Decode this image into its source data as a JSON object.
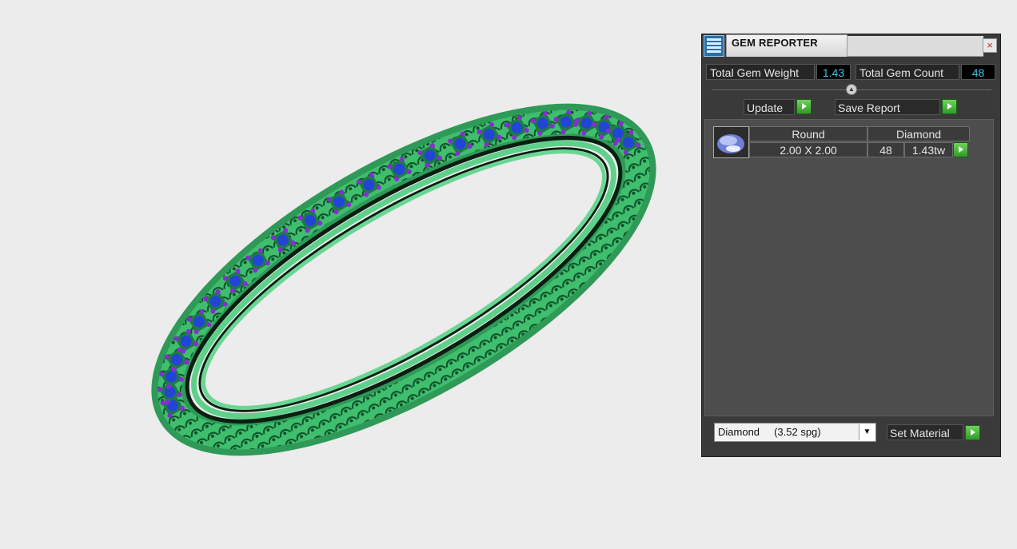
{
  "panel": {
    "title": "GEM REPORTER",
    "close_symbol": "×",
    "app_icon": "gem-reporter-icon",
    "total_gem_weight_label": "Total Gem Weight",
    "total_gem_weight_value": "1.43",
    "total_gem_count_label": "Total Gem Count",
    "total_gem_count_value": "48",
    "update_label": "Update",
    "save_report_label": "Save Report",
    "gem_rows": [
      {
        "shape": "Round",
        "material": "Diamond",
        "size": "2.00 X 2.00",
        "count": "48",
        "weight": "1.43tw",
        "thumb_icon": "round-gem-icon"
      }
    ],
    "material_select_value": "Diamond     (3.52 spg)",
    "set_material_label": "Set Material"
  },
  "colors": {
    "metal": "#4fc27b",
    "metal_dark": "#1f7a45",
    "gem_blue": "#2245d6",
    "prong_purple": "#8a2bd8",
    "accent_value": "#38c9e6",
    "go_green": "#3fae2f"
  }
}
